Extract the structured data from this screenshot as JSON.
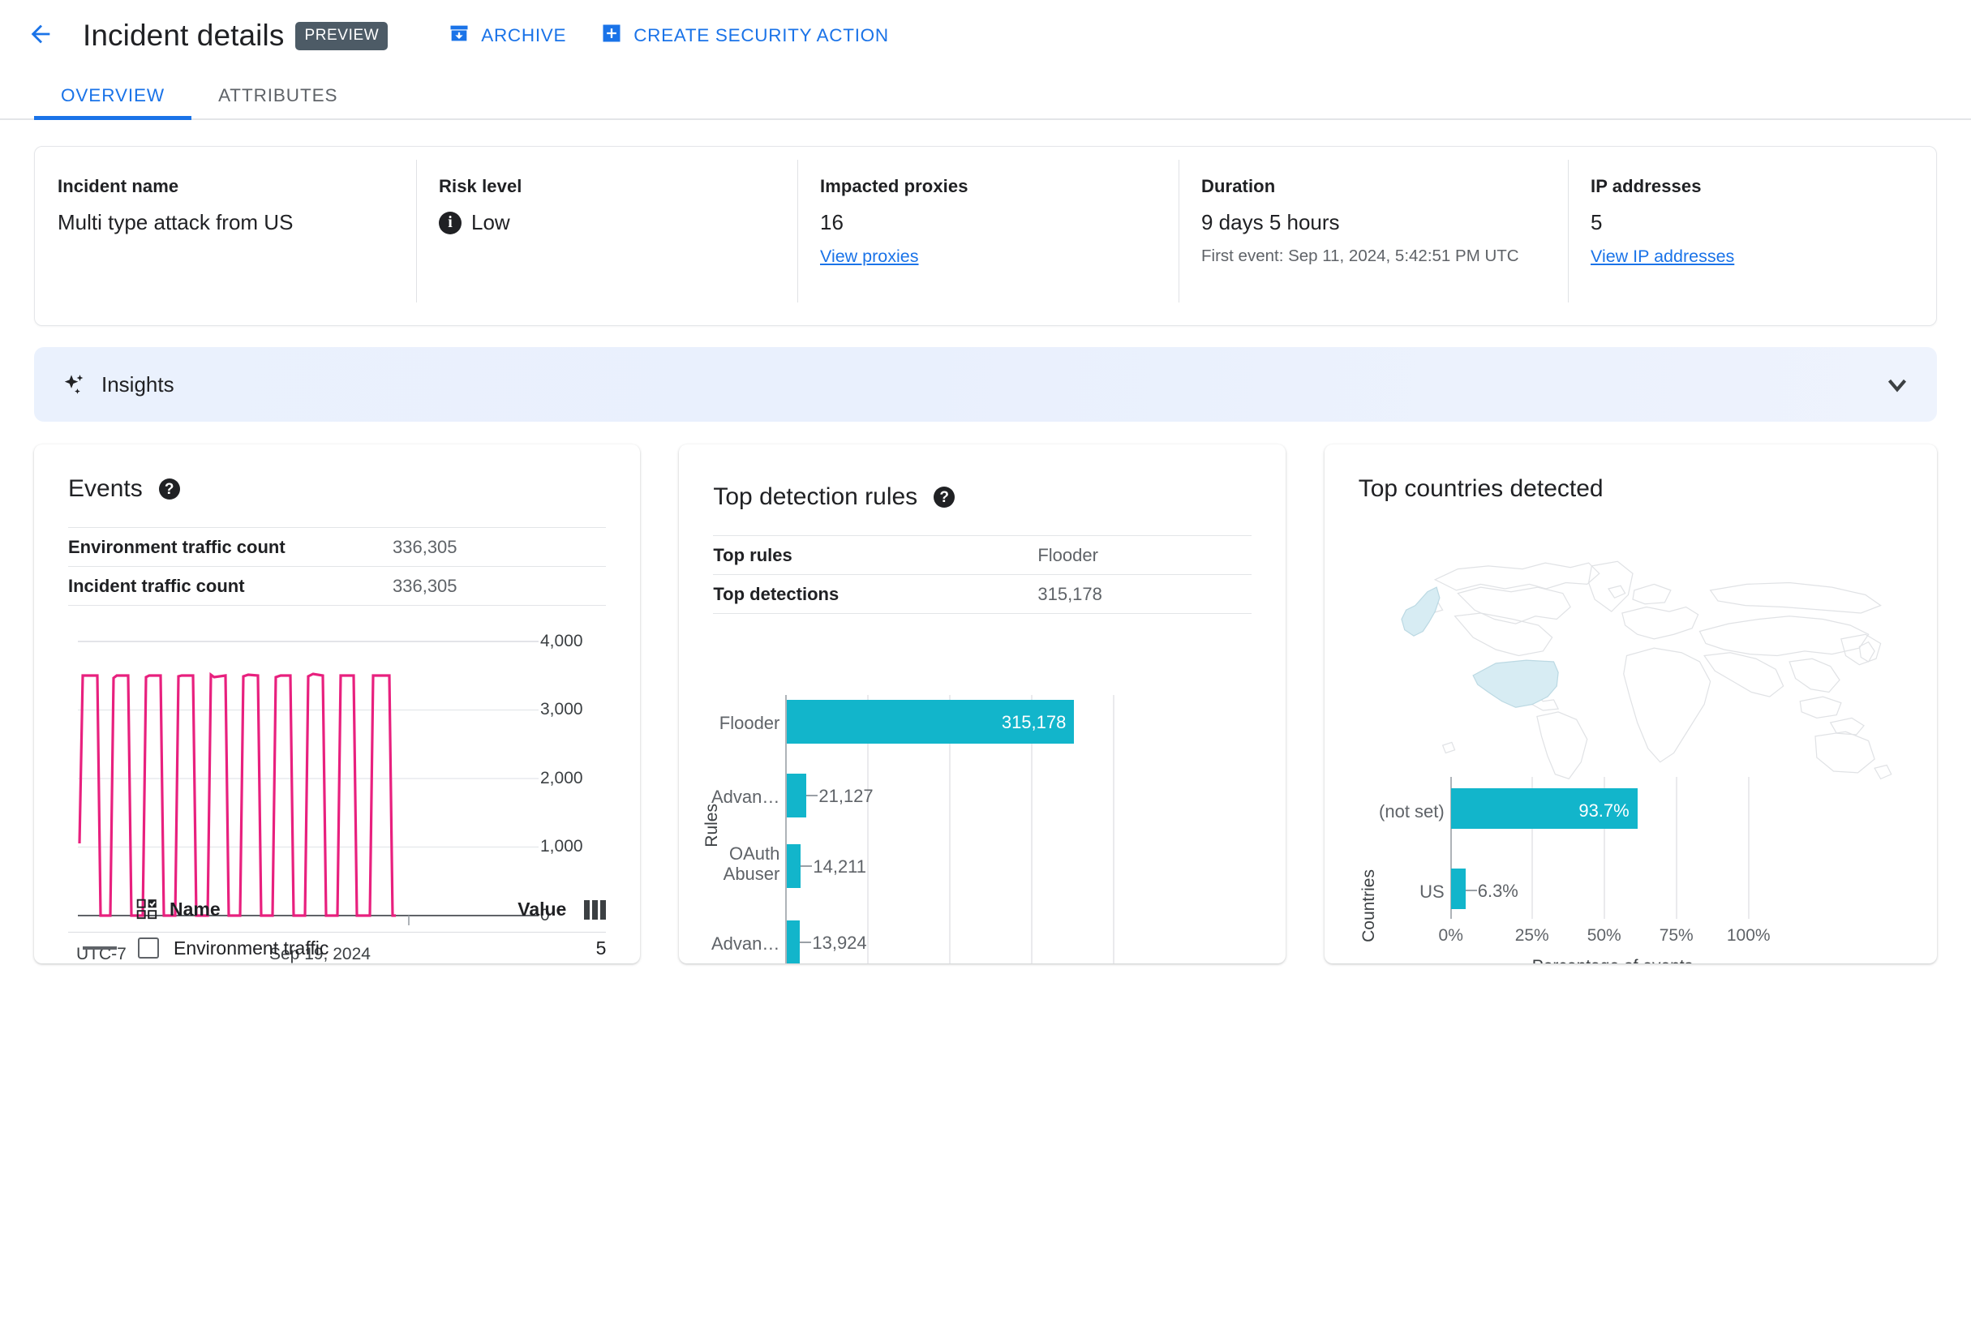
{
  "header": {
    "back_icon": "arrow-back-icon",
    "title": "Incident details",
    "preview_badge": "PREVIEW",
    "actions": [
      {
        "label": "ARCHIVE",
        "icon": "archive-icon"
      },
      {
        "label": "CREATE SECURITY ACTION",
        "icon": "add-box-icon"
      }
    ]
  },
  "tabs": [
    {
      "label": "OVERVIEW",
      "active": true
    },
    {
      "label": "ATTRIBUTES",
      "active": false
    }
  ],
  "summary": {
    "incident_name": {
      "label": "Incident name",
      "value": "Multi type attack from US"
    },
    "risk_level": {
      "label": "Risk level",
      "value": "Low",
      "icon": "info-icon"
    },
    "impacted_proxies": {
      "label": "Impacted proxies",
      "value": "16",
      "link": "View proxies"
    },
    "duration": {
      "label": "Duration",
      "value": "9 days 5 hours",
      "sub": "First event: Sep 11, 2024, 5:42:51 PM UTC"
    },
    "ip_addresses": {
      "label": "IP addresses",
      "value": "5",
      "link": "View IP addresses"
    }
  },
  "insights": {
    "title": "Insights",
    "icon": "sparkle-icon",
    "chevron": "chevron-down-icon"
  },
  "events_card": {
    "title": "Events",
    "help_icon": "help-icon",
    "rows": [
      {
        "key": "Environment traffic count",
        "value": "336,305"
      },
      {
        "key": "Incident traffic count",
        "value": "336,305"
      }
    ],
    "legend": {
      "name_header": "Name",
      "value_header": "Value",
      "select_icon": "select-all-icon",
      "columns_icon": "columns-icon",
      "rows": [
        {
          "name": "Environment traffic",
          "value": "5"
        }
      ]
    }
  },
  "rules_card": {
    "title": "Top detection rules",
    "help_icon": "help-icon",
    "rows": [
      {
        "key": "Top rules",
        "value": "Flooder"
      },
      {
        "key": "Top detections",
        "value": "315,178"
      }
    ]
  },
  "countries_card": {
    "title": "Top countries detected"
  },
  "colors": {
    "accent_blue": "#1a73e8",
    "teal": "#12b5cb",
    "pink": "#e8207e",
    "map_highlight": "#d7ecf3",
    "map_outline": "#dadce0"
  },
  "chart_data": [
    {
      "type": "line",
      "id": "events-timeline",
      "title": "Events",
      "xlabel": "",
      "ylabel": "",
      "ylim": [
        0,
        4000
      ],
      "yticks": [
        0,
        1000,
        2000,
        3000,
        4000
      ],
      "ytick_labels": [
        "0",
        "1,000",
        "2,000",
        "3,000",
        "4,000"
      ],
      "x_axis_left_label": "UTC-7",
      "x_axis_tick_label": "Sep 19, 2024",
      "series": [
        {
          "name": "Environment traffic",
          "color": "#e8207e",
          "pattern": "sawtooth",
          "cycles": 10,
          "peak": 3500,
          "trough": 0,
          "values": [
            1050,
            3500,
            3500,
            0,
            3430,
            3500,
            3500,
            0,
            3480,
            3500,
            3500,
            0,
            3490,
            3500,
            3500,
            0,
            3450,
            3500,
            3500,
            0,
            3500,
            3500,
            3500,
            0,
            3470,
            3500,
            3500,
            0,
            3440,
            3500,
            3500,
            0,
            3500,
            3500,
            3500,
            0,
            3500,
            3500,
            3500
          ]
        }
      ],
      "grid": true,
      "legend_position": "bottom"
    },
    {
      "type": "bar",
      "id": "top-detection-rules",
      "orientation": "horizontal",
      "title": "Top detection rules",
      "xlabel": "",
      "ylabel": "Rules",
      "categories": [
        "Flooder",
        "Advan…",
        "OAuth Abuser",
        "Advan…"
      ],
      "values": [
        315178,
        21127,
        14211,
        13924
      ],
      "value_labels": [
        "315,178",
        "21,127",
        "14,211",
        "13,924"
      ],
      "xlim": [
        0,
        350000
      ],
      "color": "#12b5cb",
      "grid": true
    },
    {
      "type": "bar",
      "id": "top-countries-detected",
      "orientation": "horizontal",
      "title": "Top countries detected",
      "xlabel": "Percentage of events",
      "ylabel": "Countries",
      "categories": [
        "(not set)",
        "US"
      ],
      "values": [
        93.7,
        6.3
      ],
      "value_labels": [
        "93.7%",
        "6.3%"
      ],
      "xlim": [
        0,
        100
      ],
      "xticks": [
        0,
        25,
        50,
        75,
        100
      ],
      "xtick_labels": [
        "0%",
        "25%",
        "50%",
        "75%",
        "100%"
      ],
      "color": "#12b5cb",
      "grid": true,
      "map_highlighted_regions": [
        "US",
        "Alaska"
      ]
    }
  ]
}
